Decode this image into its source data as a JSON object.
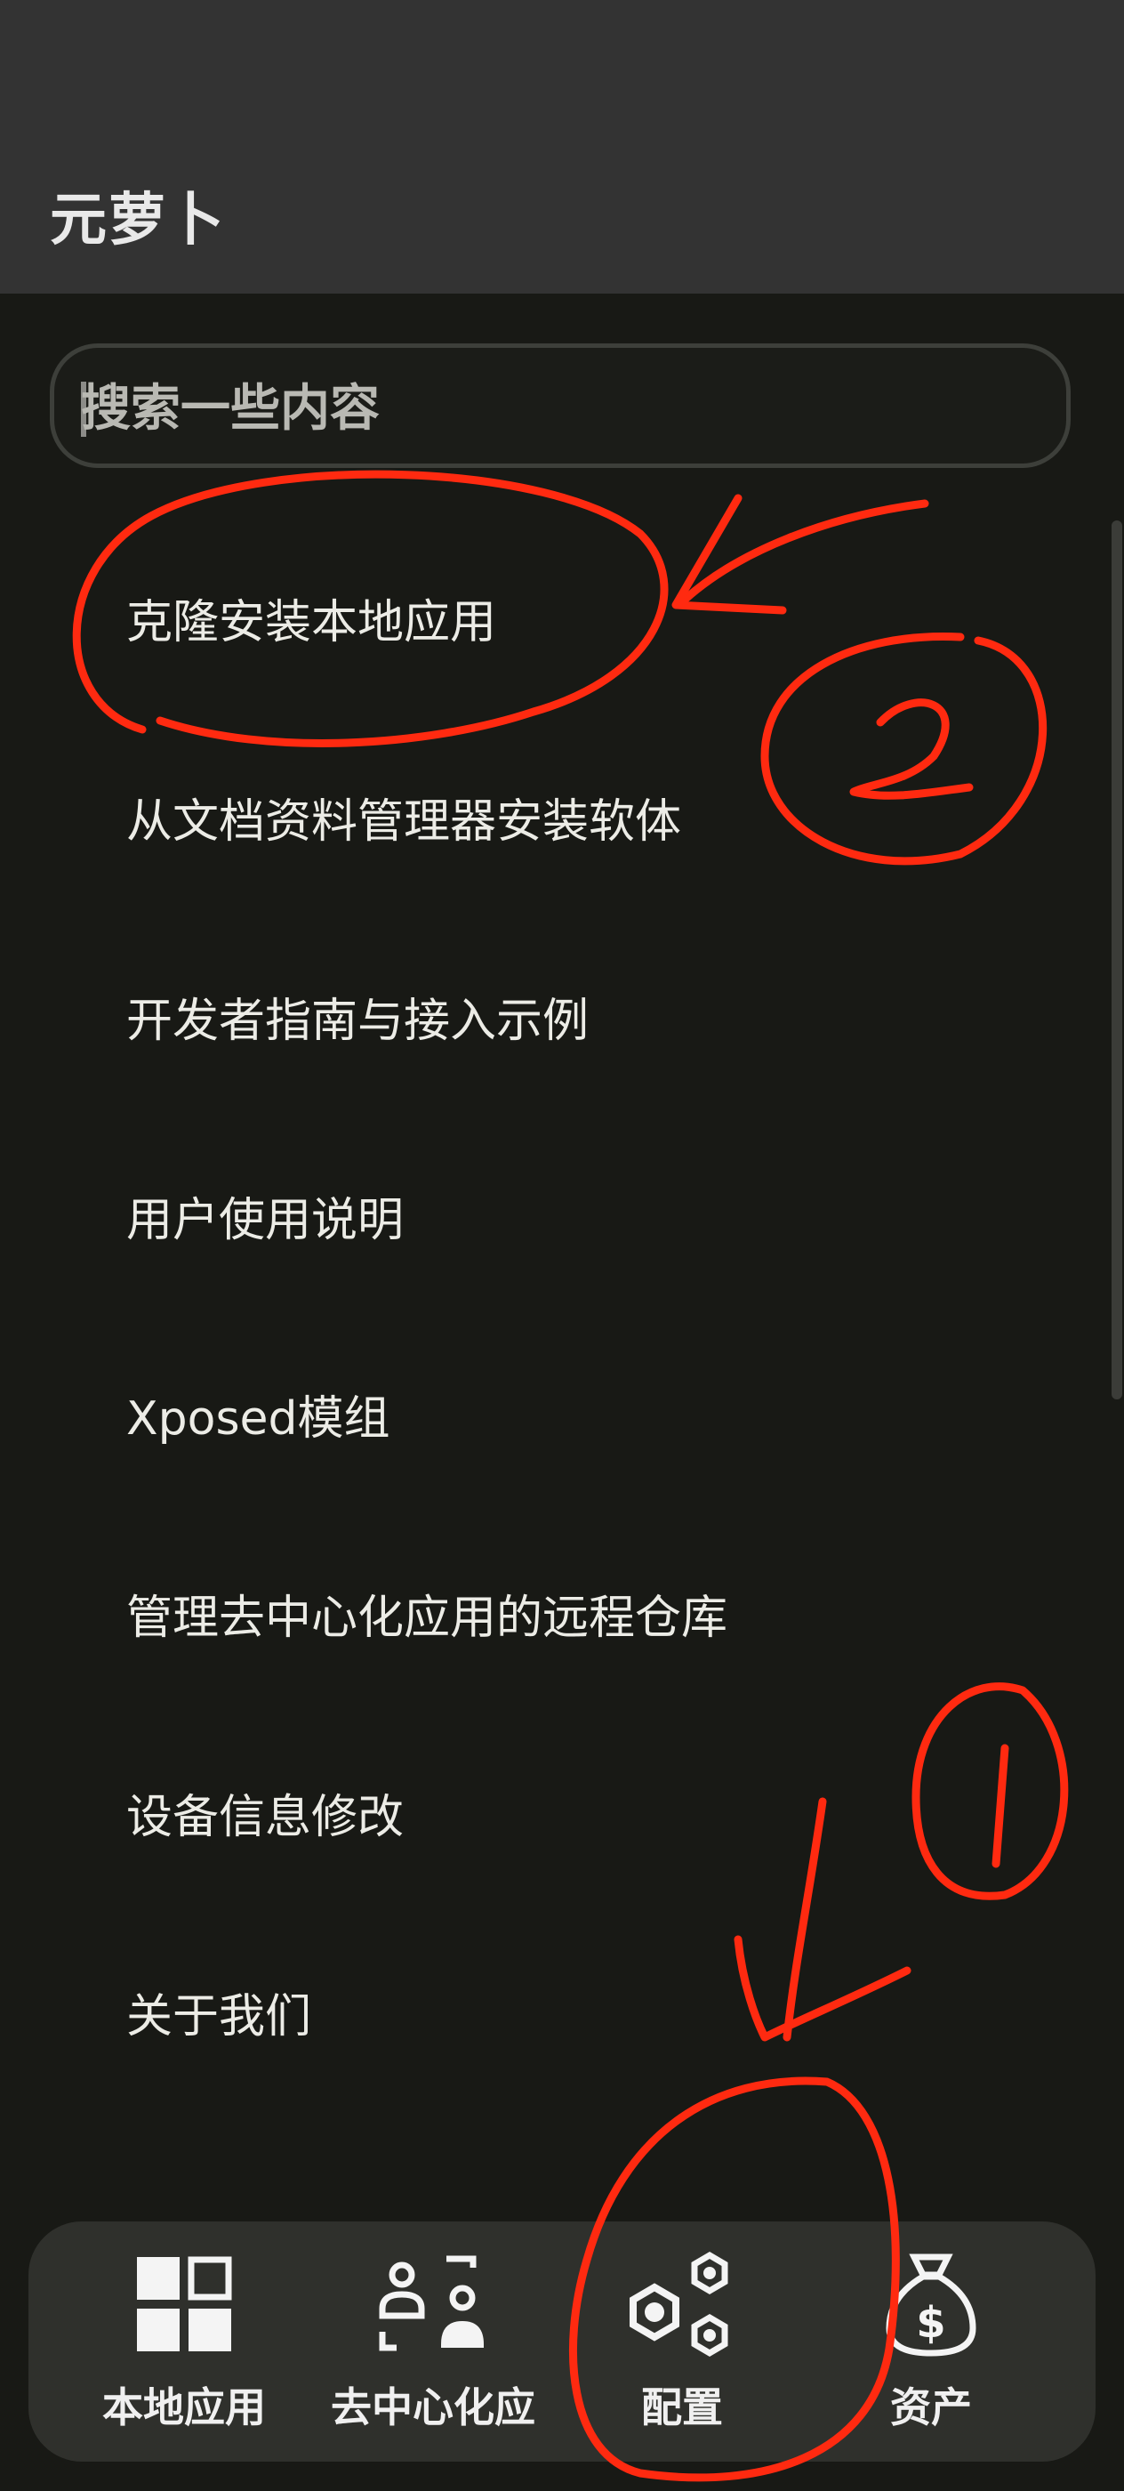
{
  "header": {
    "title": "元萝卜"
  },
  "search": {
    "placeholder": "搜索一些内容"
  },
  "menu": {
    "items": [
      {
        "label": "克隆安装本地应用"
      },
      {
        "label": "从文档资料管理器安装软体"
      },
      {
        "label": "开发者指南与接入示例"
      },
      {
        "label": "用户使用说明"
      },
      {
        "label": "Xposed模组"
      },
      {
        "label": "管理去中心化应用的远程仓库"
      },
      {
        "label": "设备信息修改"
      },
      {
        "label": "关于我们"
      }
    ]
  },
  "bottom_nav": {
    "items": [
      {
        "label": "本地应用",
        "icon": "grid-apps-icon"
      },
      {
        "label": "去中心化应",
        "icon": "decentralized-users-icon"
      },
      {
        "label": "配置",
        "icon": "hexagon-nuts-icon"
      },
      {
        "label": "资产",
        "icon": "money-bag-icon"
      }
    ]
  },
  "annotations": {
    "mark_1": "1",
    "mark_2": "2",
    "color": "#ff2a10"
  },
  "colors": {
    "background": "#181915",
    "topbar": "#333333",
    "nav": "#2f302c"
  }
}
